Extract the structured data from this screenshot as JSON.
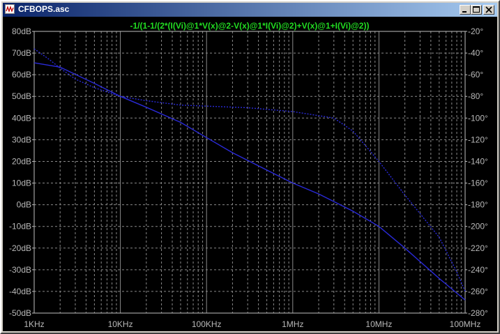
{
  "window": {
    "title": "CFBOPS.asc",
    "buttons": {
      "minimize": "minimize",
      "maximize": "maximize",
      "close": "close"
    }
  },
  "plot": {
    "trace_expression": "-1/(1-1/(2*(I(Vi)@1*V(x)@2-V(x)@1*I(Vi)@2)+V(x)@1+I(Vi)@2))",
    "colors": {
      "background": "#000000",
      "grid": "#8a8a8a",
      "axis_text": "#b8b8b8",
      "trace_label": "#22dd22",
      "magnitude_trace": "#2a2ad8",
      "phase_trace": "#2a2ad8"
    }
  },
  "chart_data": {
    "type": "line",
    "title": "-1/(1-1/(2*(I(Vi)@1*V(x)@2-V(x)@1*I(Vi)@2)+V(x)@1+I(Vi)@2))",
    "xscale": "log",
    "xlim": [
      1000,
      100000000
    ],
    "x_ticks": [
      {
        "value": 1000,
        "label": "1KHz"
      },
      {
        "value": 10000,
        "label": "10KHz"
      },
      {
        "value": 100000,
        "label": "100KHz"
      },
      {
        "value": 1000000,
        "label": "1MHz"
      },
      {
        "value": 10000000,
        "label": "10MHz"
      },
      {
        "value": 100000000,
        "label": "100MHz"
      }
    ],
    "y_left": {
      "unit": "dB",
      "lim": [
        -50,
        80
      ],
      "ticks": [
        "80dB",
        "70dB",
        "60dB",
        "50dB",
        "40dB",
        "30dB",
        "20dB",
        "10dB",
        "0dB",
        "-10dB",
        "-20dB",
        "-30dB",
        "-40dB",
        "-50dB"
      ]
    },
    "y_right": {
      "unit": "°",
      "lim": [
        -280,
        -20
      ],
      "ticks": [
        "-20°",
        "-40°",
        "-60°",
        "-80°",
        "-100°",
        "-120°",
        "-140°",
        "-160°",
        "-180°",
        "-200°",
        "-220°",
        "-240°",
        "-260°",
        "-280°"
      ]
    },
    "grid": true,
    "series": [
      {
        "axis": "left",
        "style": "solid",
        "x": [
          1000,
          2000,
          5000,
          10000,
          20000,
          50000,
          100000,
          200000,
          500000,
          1000000,
          2000000,
          5000000,
          10000000,
          20000000,
          50000000,
          100000000
        ],
        "values": [
          65.5,
          63.5,
          56,
          50,
          45,
          38,
          31,
          24,
          16,
          10,
          5,
          -3,
          -10,
          -20,
          -34,
          -44
        ]
      },
      {
        "axis": "right",
        "style": "dashed",
        "x": [
          1000,
          1500,
          2000,
          3000,
          5000,
          10000,
          20000,
          50000,
          100000,
          300000,
          1000000,
          3000000,
          5000000,
          10000000,
          20000000,
          50000000,
          80000000,
          100000000
        ],
        "values": [
          -36,
          -46,
          -54,
          -64,
          -72,
          -80,
          -84,
          -88,
          -89,
          -90.5,
          -94,
          -100,
          -112,
          -140,
          -171,
          -210,
          -242,
          -260
        ]
      }
    ]
  }
}
